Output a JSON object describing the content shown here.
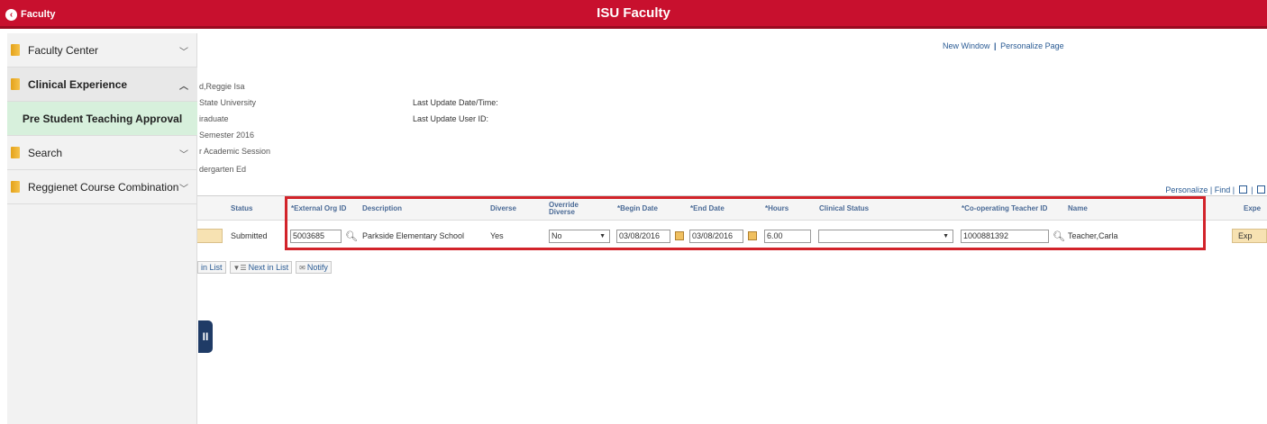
{
  "header": {
    "back_label": "Faculty",
    "title": "ISU Faculty"
  },
  "sidebar": {
    "items": [
      {
        "label": "Faculty Center"
      },
      {
        "label": "Clinical Experience"
      },
      {
        "label": "Search"
      },
      {
        "label": "Reggienet Course Combination"
      }
    ],
    "sub_item": "Pre Student Teaching Approval"
  },
  "page_links": {
    "new_window": "New Window",
    "separator": "|",
    "personalize_page": "Personalize Page"
  },
  "info": {
    "left_lines": [
      "d,Reggie Isa",
      "State University",
      "iraduate",
      "Semester 2016",
      "r Academic Session",
      "dergarten Ed"
    ],
    "last_update_datetime_label": "Last Update Date/Time:",
    "last_update_user_label": "Last Update User ID:"
  },
  "grid_links": {
    "personalize": "Personalize",
    "separator": "|",
    "find": "Find"
  },
  "grid": {
    "headers": {
      "status": "Status",
      "ext_org": "*External Org ID",
      "description": "Description",
      "diverse": "Diverse",
      "override": "Override Diverse",
      "begin": "*Begin Date",
      "end": "*End Date",
      "hours": "*Hours",
      "clinical_status": "Clinical Status",
      "coop_teacher": "*Co-operating Teacher ID",
      "name": "Name",
      "expe": "Expe"
    },
    "row": {
      "status": "Submitted",
      "ext_org": "5003685",
      "description": "Parkside Elementary School",
      "diverse": "Yes",
      "override": "No",
      "begin": "03/08/2016",
      "end": "03/08/2016",
      "hours": "6.00",
      "clinical_status": "",
      "coop_teacher": "1000881392",
      "name": "Teacher,Carla",
      "exp_button": "Exp"
    }
  },
  "nav_buttons": {
    "prev": "in List",
    "next": "Next in List",
    "notify": "Notify"
  },
  "colors": {
    "brand_red": "#c8102e",
    "highlight_red": "#d2232a",
    "active_green": "#d7f0dc",
    "link_blue": "#2a5b94",
    "pause_navy": "#1f3b66"
  }
}
